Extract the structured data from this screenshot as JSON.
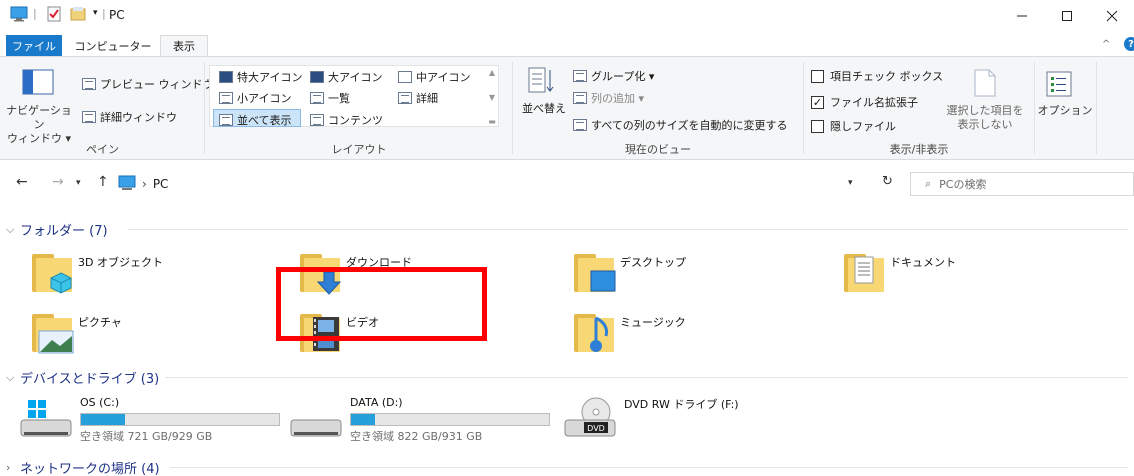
{
  "window": {
    "title": "PC",
    "title_separators": "| ▾ |"
  },
  "tabs": [
    {
      "label": "ファイル"
    },
    {
      "label": "コンピューター"
    },
    {
      "label": "表示"
    }
  ],
  "ribbon": {
    "pane_group": {
      "nav_pane_line1": "ナビゲーション",
      "nav_pane_line2": "ウィンドウ ▾",
      "preview_pane": "プレビュー ウィンドウ",
      "details_pane": "詳細ウィンドウ",
      "label": "ペイン"
    },
    "layout_group": {
      "extra_large": "特大アイコン",
      "large": "大アイコン",
      "medium": "中アイコン",
      "small": "小アイコン",
      "list": "一覧",
      "details": "詳細",
      "tiles": "並べて表示",
      "content": "コンテンツ",
      "label": "レイアウト"
    },
    "current_view_group": {
      "sort_by": "並べ替え",
      "group_by": "グループ化 ▾",
      "add_columns": "列の追加 ▾",
      "size_all_columns": "すべての列のサイズを自動的に変更する",
      "label": "現在のビュー"
    },
    "show_hide_group": {
      "item_checkboxes": "項目チェック ボックス",
      "item_checkboxes_checked": false,
      "file_extensions": "ファイル名拡張子",
      "file_extensions_checked": true,
      "hidden_items": "隠しファイル",
      "hidden_items_checked": false,
      "hide_selected_line1": "選択した項目を",
      "hide_selected_line2": "表示しない",
      "label": "表示/非表示"
    },
    "options": "オプション"
  },
  "address": {
    "path": "PC",
    "search_placeholder": "PCの検索"
  },
  "sections": {
    "folders": "フォルダー (7)",
    "devices": "デバイスとドライブ (3)",
    "network": "ネットワークの場所 (4)"
  },
  "folders": [
    {
      "name": "3D オブジェクト"
    },
    {
      "name": "ダウンロード"
    },
    {
      "name": "デスクトップ"
    },
    {
      "name": "ドキュメント"
    },
    {
      "name": "ピクチャ"
    },
    {
      "name": "ビデオ"
    },
    {
      "name": "ミュージック"
    }
  ],
  "drives": [
    {
      "name": "OS (C:)",
      "free": "空き領域 721 GB/929 GB",
      "used_fraction": 0.22
    },
    {
      "name": "DATA (D:)",
      "free": "空き領域 822 GB/931 GB",
      "used_fraction": 0.12
    },
    {
      "name": "DVD RW ドライブ (F:)"
    }
  ],
  "colors": {
    "accent": "#1979ca",
    "section_header": "#1e3287",
    "drive_bar": "#26a0da",
    "highlight": "#ff0000",
    "folder": "#f8d775"
  }
}
